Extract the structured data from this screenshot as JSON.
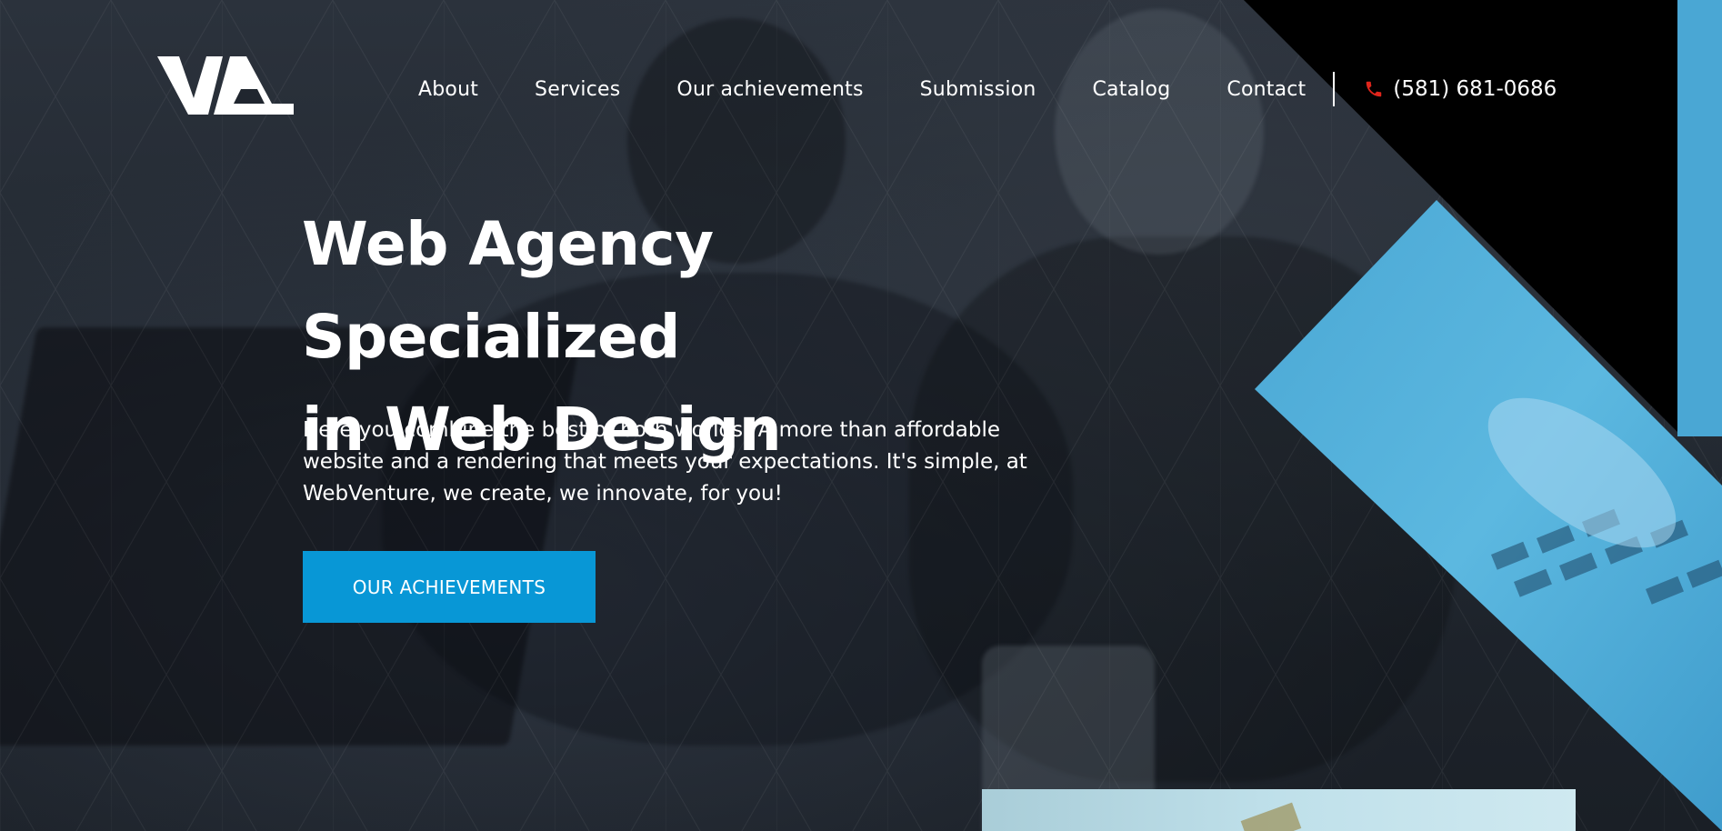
{
  "brand": {
    "logo_alt": "WA",
    "accent_color": "#0897d6",
    "phone_icon_color": "#e0251b"
  },
  "nav": {
    "items": [
      {
        "label": "About"
      },
      {
        "label": "Services"
      },
      {
        "label": "Our achievements"
      },
      {
        "label": "Submission"
      },
      {
        "label": "Catalog"
      },
      {
        "label": "Contact"
      }
    ],
    "phone": "(581) 681-0686"
  },
  "hero": {
    "headline_line1": "Web Agency Specialized",
    "headline_line2": "in Web Design",
    "lead": "Here you combine the best of both worlds! A more than affordable website and a rendering that meets your expectations. It's simple, at WebVenture, we create, we innovate, for you!",
    "cta_label": "OUR ACHIEVEMENTS"
  }
}
